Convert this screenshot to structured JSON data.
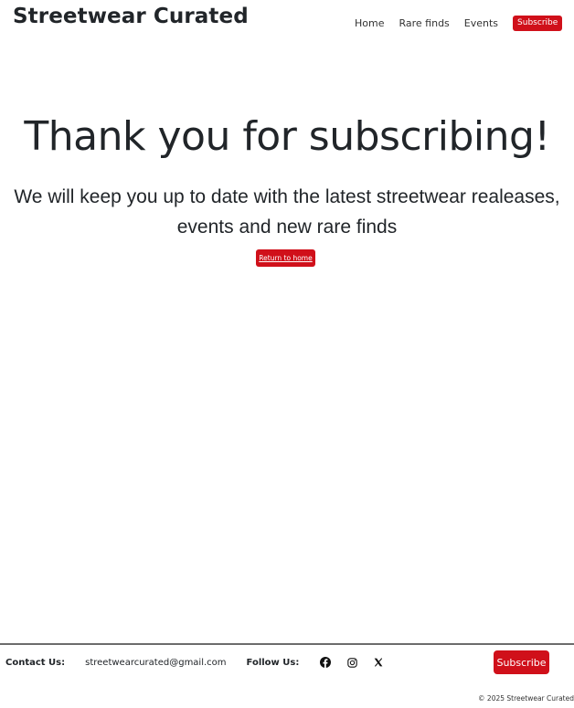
{
  "nav": {
    "brand": "Streetwear Curated",
    "links": [
      "Home",
      "Rare finds",
      "Events"
    ],
    "subscribe_label": "Subscribe"
  },
  "hero": {
    "title": "Thank you for subscribing!",
    "subtitle": "We will keep you up to date with the latest streetwear realeases, events and new rare finds",
    "return_label": "Return to home"
  },
  "footer": {
    "contact_label": "Contact Us:",
    "email": "streetwearcurated@gmail.com",
    "follow_label": "Follow Us:",
    "social_icons": [
      "facebook-icon",
      "instagram-icon",
      "x-icon"
    ],
    "subscribe_label": "Subscribe",
    "copyright": "© 2025 Streetwear Curated"
  },
  "colors": {
    "accent": "#d0101a",
    "text": "#212529",
    "divider": "#6c6c6c"
  }
}
